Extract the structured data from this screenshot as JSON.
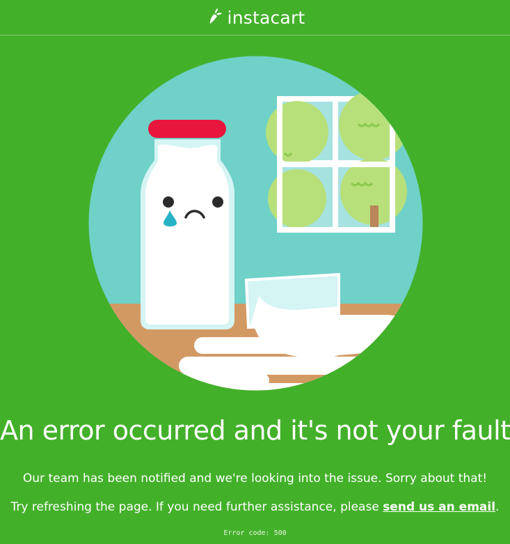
{
  "header": {
    "logo_text": "instacart"
  },
  "illustration": {
    "icon": "spilled-milk-illustration"
  },
  "main": {
    "headline": "An error occurred and it's not your fault.",
    "message_line1": "Our team has been notified and we're looking into the issue. Sorry about that!",
    "message_line2_prefix": "Try refreshing the page. If you need further assistance, please ",
    "email_link_text": "send us an email",
    "message_line2_suffix": ".",
    "error_code": "Error code: 500"
  },
  "colors": {
    "background": "#43b02a",
    "circle": "#6fd1c8",
    "table": "#d39963",
    "bottle_cap": "#e8153d",
    "tear": "#27b3c6"
  }
}
